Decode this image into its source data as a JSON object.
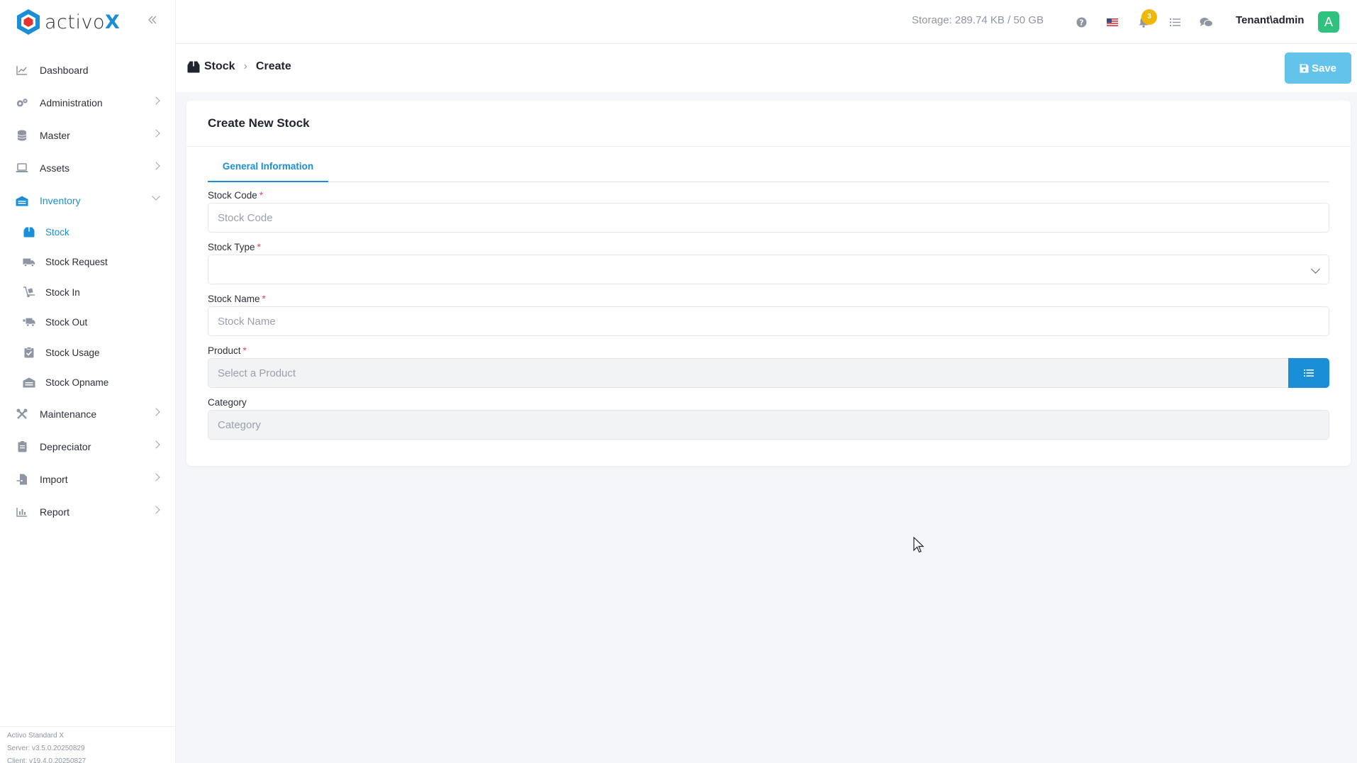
{
  "app": {
    "logo_text": "activo",
    "logo_accent": "X",
    "brand_color": "#1a8fd8"
  },
  "sidebar": {
    "collapse_icon": "double-chevron-left-icon",
    "items": [
      {
        "label": "Dashboard",
        "icon": "chart-line-icon"
      },
      {
        "label": "Administration",
        "icon": "gears-icon"
      },
      {
        "label": "Master",
        "icon": "database-icon"
      },
      {
        "label": "Assets",
        "icon": "laptop-icon"
      },
      {
        "label": "Inventory",
        "icon": "warehouse-icon",
        "expanded": true,
        "children": [
          {
            "label": "Stock",
            "icon": "box-icon",
            "active": true
          },
          {
            "label": "Stock Request",
            "icon": "truck-icon"
          },
          {
            "label": "Stock In",
            "icon": "dolly-icon"
          },
          {
            "label": "Stock Out",
            "icon": "truck-ramp-icon"
          },
          {
            "label": "Stock Usage",
            "icon": "clipboard-check-icon"
          },
          {
            "label": "Stock Opname",
            "icon": "warehouse-icon"
          }
        ]
      },
      {
        "label": "Maintenance",
        "icon": "tools-icon"
      },
      {
        "label": "Depreciator",
        "icon": "calculator-icon"
      },
      {
        "label": "Import",
        "icon": "file-import-icon"
      },
      {
        "label": "Report",
        "icon": "chart-bar-icon"
      }
    ],
    "footer": {
      "edition": "Activo Standard X",
      "server": "Server: v3.5.0.20250829",
      "client": "Client: v19.4.0.20250827"
    }
  },
  "topbar": {
    "storage": "Storage: 289.74 KB / 50 GB",
    "notification_count": "3",
    "user": "Tenant\\admin",
    "avatar_initial": "A",
    "icons": [
      "help-icon",
      "flag-us-icon",
      "bell-icon",
      "task-list-icon",
      "chat-icon"
    ]
  },
  "breadcrumb": {
    "parent": "Stock",
    "current": "Create"
  },
  "toolbar": {
    "save_label": "Save"
  },
  "form": {
    "title": "Create New Stock",
    "tab": "General Information",
    "fields": {
      "stock_code": {
        "label": "Stock Code",
        "required": "*",
        "placeholder": "Stock Code",
        "value": ""
      },
      "stock_type": {
        "label": "Stock Type",
        "required": "*",
        "value": ""
      },
      "stock_name": {
        "label": "Stock Name",
        "required": "*",
        "placeholder": "Stock Name",
        "value": ""
      },
      "product": {
        "label": "Product",
        "required": "*",
        "placeholder": "Select a Product",
        "value": ""
      },
      "category": {
        "label": "Category",
        "placeholder": "Category",
        "value": ""
      }
    }
  }
}
